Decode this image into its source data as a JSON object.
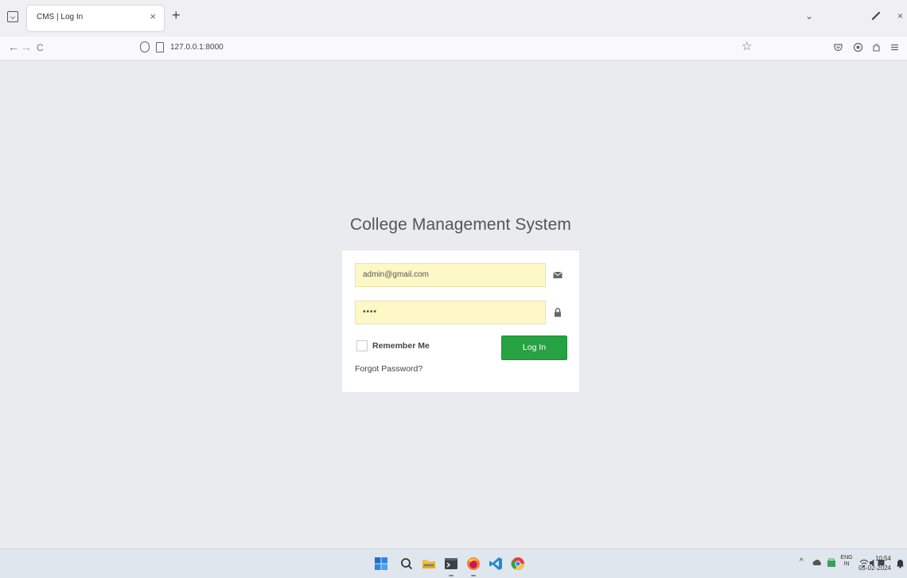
{
  "browser": {
    "tab_title": "CMS | Log In",
    "tab_close": "×",
    "new_tab": "+",
    "window_min": "⌄",
    "window_close": "×",
    "url": "127.0.0.1:8000",
    "back": "←",
    "forward": "→",
    "reload": "C",
    "bookmark": "☆"
  },
  "page": {
    "brand_title": "College Management System",
    "email_value": "admin@gmail.com",
    "password_value": "••••",
    "remember_label": "Remember Me",
    "login_label": "Log In",
    "forgot_label": "Forgot Password?"
  },
  "taskbar": {
    "tray_language_top": "ENG",
    "tray_language_bottom": "IN",
    "time": "10:54",
    "date": "05-02-2024"
  },
  "colors": {
    "login_button": "#27a243",
    "input_autofill": "#fdf8c6",
    "page_background": "#e9ebee"
  }
}
